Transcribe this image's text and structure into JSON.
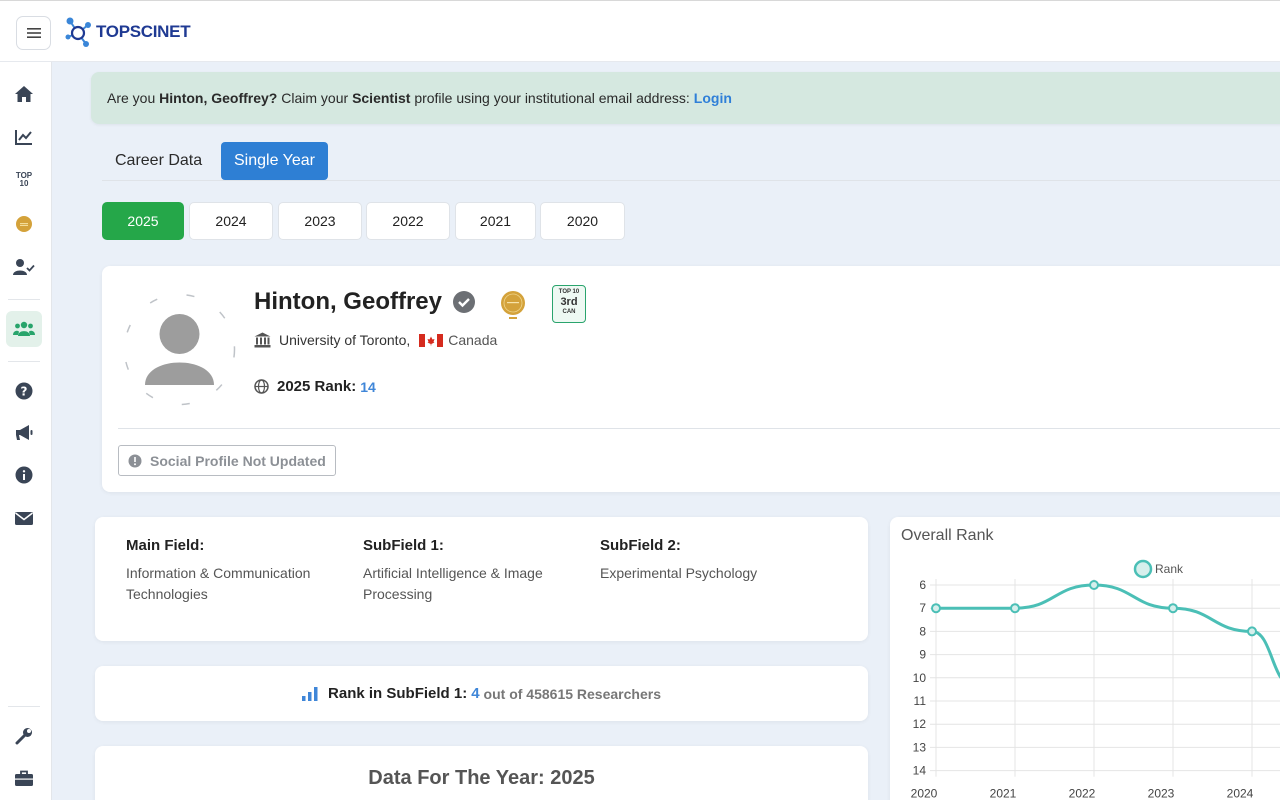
{
  "header": {
    "logo_text": "TOPSCINET"
  },
  "claim": {
    "prefix": "Are you",
    "name": "Hinton, Geoffrey?",
    "middle": "Claim your",
    "role": "Scientist",
    "suffix": "profile using your institutional email address:",
    "login": "Login"
  },
  "tabs": [
    "Career Data",
    "Single Year"
  ],
  "years": [
    "2025",
    "2024",
    "2023",
    "2022",
    "2021",
    "2020"
  ],
  "profile": {
    "name": "Hinton, Geoffrey",
    "institution": "University of Toronto,",
    "country": "Canada",
    "rank_label": "2025 Rank:",
    "rank_value": "14",
    "top10": {
      "line1": "TOP 10",
      "line2": "3rd",
      "line3": "CAN"
    },
    "social": "Social Profile Not Updated"
  },
  "fields": [
    {
      "heading": "Main Field:",
      "value": "Information & Communication Technologies"
    },
    {
      "heading": "SubField 1:",
      "value": "Artificial Intelligence & Image Processing"
    },
    {
      "heading": "SubField 2:",
      "value": "Experimental Psychology"
    }
  ],
  "subfield_rank": {
    "label": "Rank in SubField 1:",
    "value": "4",
    "suffix": "out of 458615 Researchers"
  },
  "year_section": {
    "title": "Data For The Year: 2025"
  },
  "chart_data": {
    "type": "line",
    "title": "Overall Rank",
    "legend": "Rank",
    "x": [
      "2020",
      "2021",
      "2022",
      "2023",
      "2024"
    ],
    "values": [
      7,
      7,
      6,
      7,
      8
    ],
    "yticks": [
      6,
      7,
      8,
      9,
      10,
      11,
      12,
      13,
      14
    ],
    "ylim": [
      6,
      14
    ],
    "y_inverted": true,
    "color": "#4bbfb6"
  },
  "colors": {
    "accent": "#2e7fd4",
    "active_year": "#25a749",
    "claim_bg": "#d5e8e0"
  }
}
